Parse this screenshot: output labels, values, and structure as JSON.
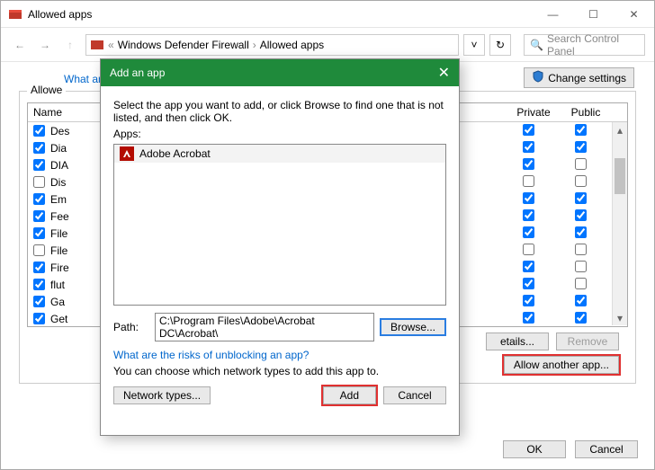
{
  "window": {
    "title": "Allowed apps"
  },
  "nav": {
    "crumb_prefix": "«",
    "crumb1": "Windows Defender Firewall",
    "crumb2": "Allowed apps",
    "search_placeholder": "Search Control Panel"
  },
  "page": {
    "question_link": "What are",
    "change_settings": "Change settings",
    "group_label": "Allowe",
    "col_name": "Name",
    "col_private": "Private",
    "col_public": "Public",
    "details_btn": "etails...",
    "remove_btn": "Remove",
    "allow_another": "Allow another app...",
    "ok": "OK",
    "cancel": "Cancel"
  },
  "rows": [
    {
      "checked": true,
      "name": "Des",
      "priv": true,
      "pub": true
    },
    {
      "checked": true,
      "name": "Dia",
      "priv": true,
      "pub": true
    },
    {
      "checked": true,
      "name": "DIA",
      "priv": true,
      "pub": false
    },
    {
      "checked": false,
      "name": "Dis",
      "priv": false,
      "pub": false
    },
    {
      "checked": true,
      "name": "Em",
      "priv": true,
      "pub": true
    },
    {
      "checked": true,
      "name": "Fee",
      "priv": true,
      "pub": true
    },
    {
      "checked": true,
      "name": "File",
      "priv": true,
      "pub": true
    },
    {
      "checked": false,
      "name": "File",
      "priv": false,
      "pub": false
    },
    {
      "checked": true,
      "name": "Fire",
      "priv": true,
      "pub": false
    },
    {
      "checked": true,
      "name": "flut",
      "priv": true,
      "pub": false
    },
    {
      "checked": true,
      "name": "Ga",
      "priv": true,
      "pub": true
    },
    {
      "checked": true,
      "name": "Get",
      "priv": true,
      "pub": true
    }
  ],
  "dialog": {
    "title": "Add an app",
    "instruction": "Select the app you want to add, or click Browse to find one that is not listed, and then click OK.",
    "apps_label": "Apps:",
    "app_item": "Adobe Acrobat",
    "path_label": "Path:",
    "path_value": "C:\\Program Files\\Adobe\\Acrobat DC\\Acrobat\\",
    "browse": "Browse...",
    "risks_link": "What are the risks of unblocking an app?",
    "note": "You can choose which network types to add this app to.",
    "network_types": "Network types...",
    "add": "Add",
    "cancel": "Cancel"
  }
}
